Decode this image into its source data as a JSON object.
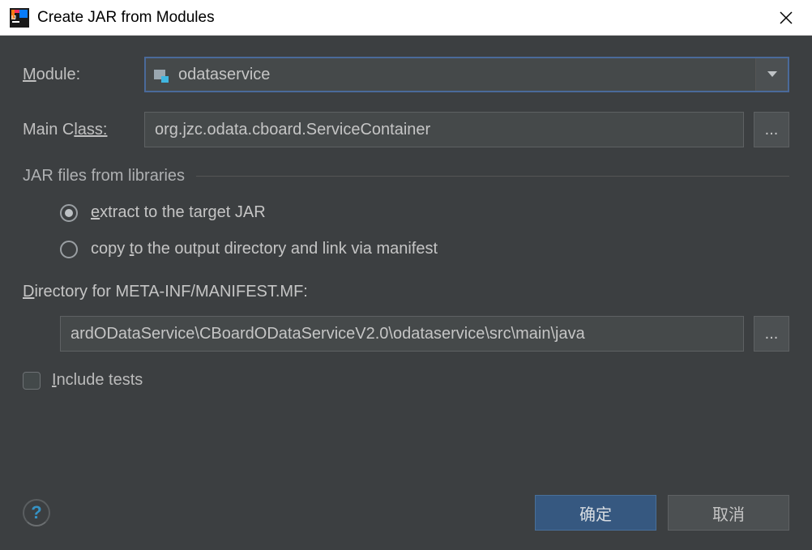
{
  "title": "Create JAR from Modules",
  "labels": {
    "module": "odule:",
    "module_prefix": "M",
    "main_class": "lass:",
    "main_class_prefix": "Main C",
    "section": "JAR files from libraries",
    "radio_extract_pre": "e",
    "radio_extract": "xtract to the target JAR",
    "radio_copy_pre": "copy ",
    "radio_copy_u": "t",
    "radio_copy_post": "o the output directory and link via manifest",
    "dir_pre": "D",
    "dir": "irectory for META-INF/MANIFEST.MF:",
    "include_pre": "I",
    "include": "nclude tests"
  },
  "values": {
    "module": "odataservice",
    "main_class": "org.jzc.odata.cboard.ServiceContainer",
    "directory": "ardODataService\\CBoardODataServiceV2.0\\odataservice\\src\\main\\java"
  },
  "buttons": {
    "ok": "确定",
    "cancel": "取消",
    "browse": "...",
    "help": "?"
  }
}
